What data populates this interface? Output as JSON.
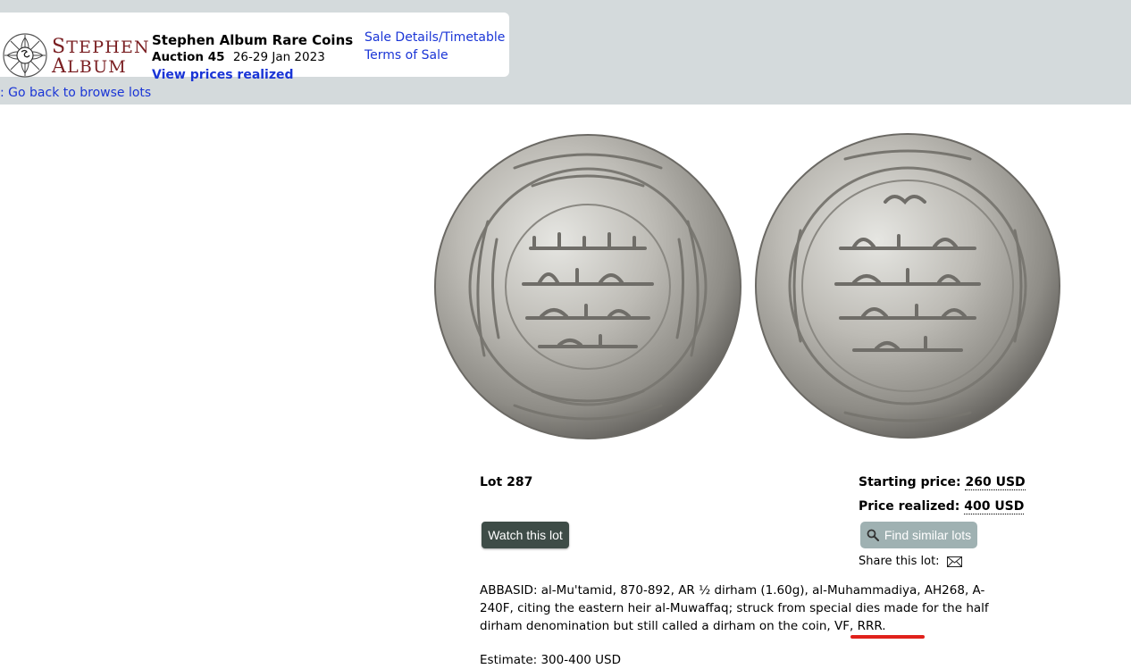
{
  "header": {
    "logo_alt": "Stephen Album",
    "logo_line1": "Stephen",
    "logo_line2": "Album",
    "title": "Stephen Album Rare Coins",
    "auction_label": "Auction 45",
    "auction_dates": "26-29 Jan 2023",
    "prices_link": "View prices realized",
    "sale_details_link": "Sale Details/Timetable",
    "terms_link": "Terms of Sale"
  },
  "nav": {
    "back_link": ": Go back to browse lots"
  },
  "lot": {
    "number_label": "Lot 287",
    "starting_price_label": "Starting price:",
    "starting_price": "260 USD",
    "realized_label": "Price realized:",
    "realized_price": "400 USD",
    "watch_button": "Watch this lot",
    "similar_button": "Find similar lots",
    "share_label": "Share this lot:",
    "description": "ABBASID: al-Mu'tamid, 870-892, AR ½ dirham (1.60g), al-Muhammadiya, AH268, A-240F, citing the eastern heir al-Muwaffaq; struck from special dies made for the half dirham denomination but still called a dirham on the coin, VF, RRR.",
    "estimate": "Estimate: 300-400 USD"
  },
  "colors": {
    "topbar": "#d4dadc",
    "link": "#1a35d6",
    "brand": "#7a1f22",
    "watch_button": "#3e4c47",
    "similar_button": "#9fb1b2",
    "highlight": "#e0211b"
  }
}
